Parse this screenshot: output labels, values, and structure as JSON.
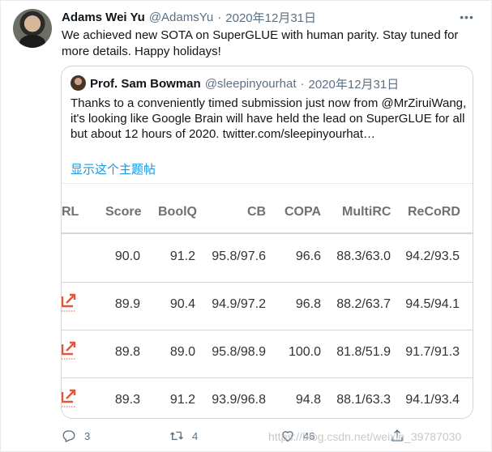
{
  "tweet": {
    "author_name": "Adams Wei Yu",
    "author_handle": "@AdamsYu",
    "separator": "·",
    "date": "2020年12月31日",
    "text": "We achieved new SOTA on SuperGLUE with human parity. Stay tuned for more details. Happy holidays!"
  },
  "quoted": {
    "author_name": "Prof. Sam Bowman",
    "author_handle": "@sleepinyourhat",
    "separator": "·",
    "date": "2020年12月31日",
    "text": "Thanks to a conveniently timed submission just now from @MrZiruiWang, it's looking like Google Brain will have held the lead on SuperGLUE for all but about 12 hours of 2020. twitter.com/sleepinyourhat…",
    "show_thread": "显示这个主题帖"
  },
  "leaderboard": {
    "columns": [
      "RL",
      "Score",
      "BoolQ",
      "CB",
      "COPA",
      "MultiRC",
      "ReCoRD"
    ],
    "rows": [
      {
        "score": "90.0",
        "boolq": "91.2",
        "cb": "95.8/97.6",
        "copa": "96.6",
        "multirc": "88.3/63.0",
        "record": "94.2/93.5",
        "has_link": false
      },
      {
        "score": "89.9",
        "boolq": "90.4",
        "cb": "94.9/97.2",
        "copa": "96.8",
        "multirc": "88.2/63.7",
        "record": "94.5/94.1",
        "has_link": true
      },
      {
        "score": "89.8",
        "boolq": "89.0",
        "cb": "95.8/98.9",
        "copa": "100.0",
        "multirc": "81.8/51.9",
        "record": "91.7/91.3",
        "has_link": true
      },
      {
        "score": "89.3",
        "boolq": "91.2",
        "cb": "93.9/96.8",
        "copa": "94.8",
        "multirc": "88.1/63.3",
        "record": "94.1/93.4",
        "has_link": true
      }
    ]
  },
  "actions": {
    "reply_count": "3",
    "retweet_count": "4",
    "like_count": "46"
  },
  "icons": {
    "more": "more-icon",
    "reply": "reply-icon",
    "retweet": "retweet-icon",
    "like": "like-icon",
    "share": "share-icon",
    "external_link": "external-link-icon"
  },
  "colors": {
    "link": "#1b95e0",
    "muted": "#5b7083",
    "external_link": "#e0573a"
  },
  "watermark": "https://blog.csdn.net/weixin_39787030"
}
